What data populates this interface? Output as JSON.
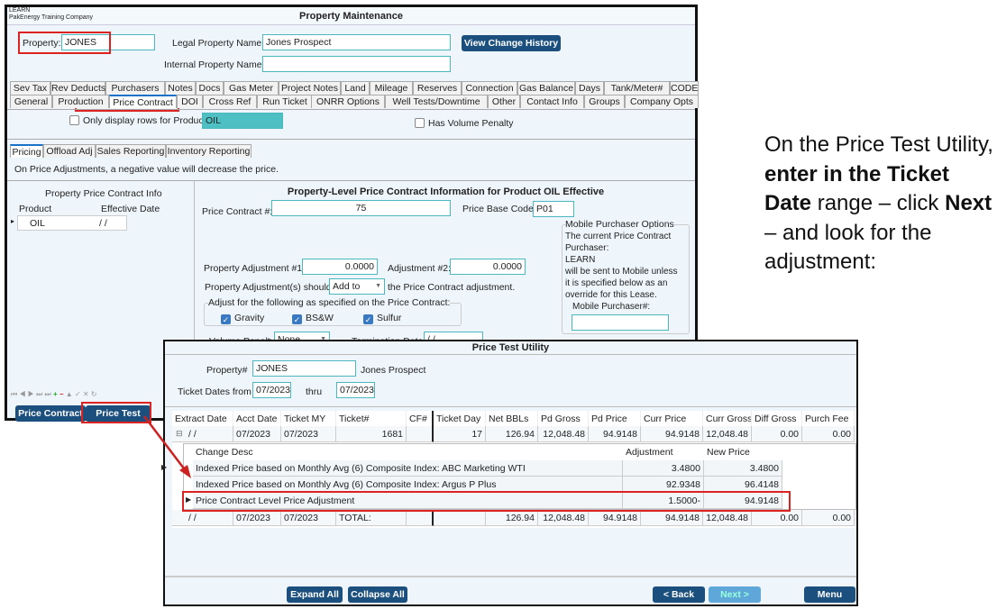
{
  "main_window": {
    "company_code": "LEARN",
    "company_name": "PakEnergy Training Company",
    "title": "Property Maintenance",
    "property_label": "Property:",
    "property_value": "JONES",
    "legal_name_label": "Legal Property Name:",
    "legal_name_value": "Jones Prospect",
    "internal_name_label": "Internal Property Name:",
    "internal_name_value": "",
    "view_history_button": "View Change History",
    "tabs_row1": [
      "Sev Tax",
      "Rev Deducts",
      "Purchasers",
      "Notes",
      "Docs",
      "Gas Meter",
      "Project Notes",
      "Land",
      "Mileage",
      "Reserves",
      "Connection",
      "Gas Balance",
      "Days",
      "Tank/Meter#",
      "CODE"
    ],
    "tabs_row2": [
      "General",
      "Production",
      "Price Contract",
      "DOI",
      "Cross Ref",
      "Run Ticket",
      "ONRR Options",
      "Well Tests/Downtime",
      "Other",
      "Contact Info",
      "Groups",
      "Company Opts"
    ],
    "active_tab": "Price Contract",
    "only_display_label": "Only display rows for Product:",
    "only_display_checked": false,
    "product_value": "OIL",
    "volume_penalty_checkbox": "Has Volume Penalty",
    "volume_penalty_checked": false,
    "subtabs": [
      "Pricing",
      "Offload Adj",
      "Sales Reporting",
      "Inventory Reporting"
    ],
    "active_subtab": "Pricing",
    "info_text": "On Price Adjustments, a negative value will decrease the price.",
    "left_grid": {
      "title": "Property Price Contract Info",
      "columns": [
        "Product",
        "Effective Date"
      ],
      "rows": [
        [
          "OIL",
          "/ /"
        ]
      ]
    },
    "section_title": "Property-Level Price Contract Information for Product OIL Effective",
    "price_contract_label": "Price Contract #:",
    "price_contract_value": "75",
    "price_base_label": "Price Base Code:",
    "price_base_value": "P01",
    "adj1_label": "Property Adjustment #1:",
    "adj1_value": "0.0000",
    "adj2_label": "Adjustment #2:",
    "adj2_value": "0.0000",
    "should_label": "Property Adjustment(s) should",
    "should_value": "Add to",
    "should_suffix": "the Price Contract adjustment.",
    "adjust_group_label": "Adjust for the following as specified on the Price Contract:",
    "adjust_checks": [
      {
        "label": "Gravity",
        "checked": true
      },
      {
        "label": "BS&W",
        "checked": true
      },
      {
        "label": "Sulfur",
        "checked": true
      }
    ],
    "volume_penalty_label": "Volume Penalty:",
    "volume_penalty_value": "None",
    "termination_label": "Termination Date:",
    "termination_value": "/ /",
    "mobile": {
      "legend": "Mobile Purchaser Options",
      "line1": "The current Price Contract",
      "line2": "Purchaser:",
      "purchaser": "LEARN",
      "line3": "will be sent to Mobile unless",
      "line4": "it is specified below as an",
      "line5": "override for this Lease.",
      "field_label": "Mobile Purchaser#:",
      "field_value": ""
    },
    "bottom_buttons": [
      "Price Contract",
      "Price Test"
    ]
  },
  "price_test": {
    "title": "Price Test Utility",
    "property_label": "Property#",
    "property_value": "JONES",
    "property_name": "Jones Prospect",
    "dates_label": "Ticket Dates from",
    "from_value": "07/2023",
    "thru_label": "thru",
    "thru_value": "07/2023",
    "columns": [
      "Extract Date",
      "Acct Date",
      "Ticket MY",
      "Ticket#",
      "CF#",
      "Ticket Day",
      "Net BBLs",
      "Pd Gross",
      "Pd Price",
      "Curr Price",
      "Curr Gross",
      "Diff Gross",
      "Purch Fee"
    ],
    "row": [
      "/ /",
      "07/2023",
      "07/2023",
      "1681",
      "",
      "17",
      "126.94",
      "12,048.48",
      "94.9148",
      "94.9148",
      "12,048.48",
      "0.00",
      "0.00"
    ],
    "detail_columns": [
      "Change Desc",
      "Adjustment",
      "New Price"
    ],
    "detail_rows": [
      [
        "Indexed Price based on Monthly Avg (6) Composite Index: ABC Marketing WTI",
        "3.4800",
        "3.4800"
      ],
      [
        "Indexed Price based on Monthly Avg (6) Composite Index: Argus P Plus",
        "92.9348",
        "96.4148"
      ],
      [
        "Price Contract Level Price Adjustment",
        "1.5000-",
        "94.9148"
      ]
    ],
    "total_row": [
      "/ /",
      "07/2023",
      "07/2023",
      "TOTAL:",
      "",
      "",
      "126.94",
      "12,048.48",
      "94.9148",
      "94.9148",
      "12,048.48",
      "0.00",
      "0.00"
    ],
    "buttons": {
      "expand": "Expand All",
      "collapse": "Collapse All",
      "back": "< Back",
      "next": "Next >",
      "menu": "Menu"
    }
  },
  "instruction": {
    "p1": "On the Price Test Utility, ",
    "b1": "enter in the Ticket Date",
    "p2": " range – click ",
    "b2": "Next",
    "p3": " – and look for the adjustment:"
  },
  "colors": {
    "button": "#1b4f7e",
    "highlight": "#d22222",
    "field_border": "#4bb8c0",
    "window_bg": "#eef6fb"
  }
}
